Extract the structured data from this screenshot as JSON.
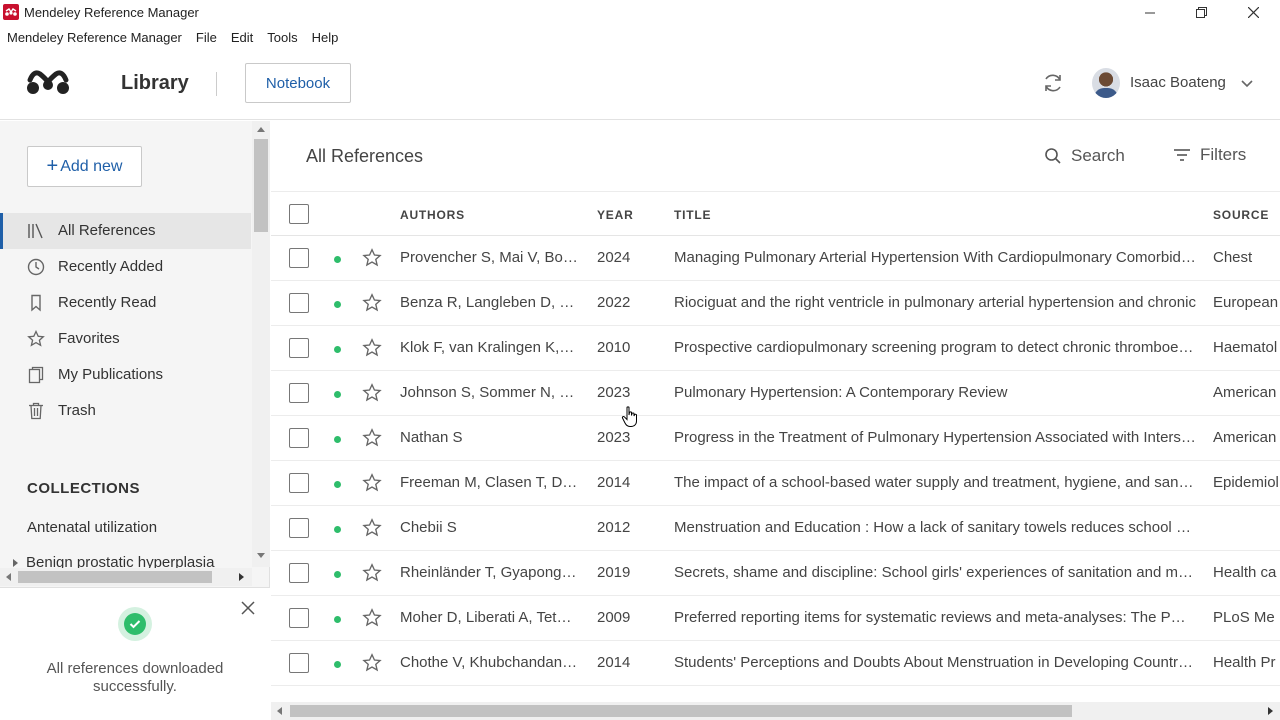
{
  "window": {
    "title": "Mendeley Reference Manager"
  },
  "menu": [
    "Mendeley Reference Manager",
    "File",
    "Edit",
    "Tools",
    "Help"
  ],
  "header": {
    "library_label": "Library",
    "notebook_label": "Notebook",
    "user_name": "Isaac Boateng"
  },
  "sidebar": {
    "add_new_label": "Add new",
    "items": [
      {
        "label": "All References",
        "icon": "library-icon",
        "active": true
      },
      {
        "label": "Recently Added",
        "icon": "clock-icon"
      },
      {
        "label": "Recently Read",
        "icon": "bookmark-icon"
      },
      {
        "label": "Favorites",
        "icon": "star-icon"
      },
      {
        "label": "My Publications",
        "icon": "publications-icon"
      },
      {
        "label": "Trash",
        "icon": "trash-icon"
      }
    ],
    "collections_header": "COLLECTIONS",
    "collections": [
      "Antenatal utilization",
      "Benign prostatic hyperplasia"
    ]
  },
  "toast": {
    "message": "All references downloaded successfully."
  },
  "main": {
    "title": "All References",
    "search_label": "Search",
    "filters_label": "Filters",
    "columns": {
      "authors": "AUTHORS",
      "year": "YEAR",
      "title": "TITLE",
      "source": "SOURCE"
    },
    "rows": [
      {
        "authors": "Provencher S, Mai V, Bonnet S",
        "year": "2024",
        "title": "Managing Pulmonary Arterial Hypertension With Cardiopulmonary Comorbidities",
        "source": "Chest"
      },
      {
        "authors": "Benza R, Langleben D, Hemnes A",
        "year": "2022",
        "title": "Riociguat and the right ventricle in pulmonary arterial hypertension and chronic",
        "source": "European"
      },
      {
        "authors": "Klok F, van Kralingen K, van Dijk A",
        "year": "2010",
        "title": "Prospective cardiopulmonary screening program to detect chronic thromboembolic",
        "source": "Haematol"
      },
      {
        "authors": "Johnson S, Sommer N, Cox-Flaherty K",
        "year": "2023",
        "title": "Pulmonary Hypertension: A Contemporary Review",
        "source": "American"
      },
      {
        "authors": "Nathan S",
        "year": "2023",
        "title": "Progress in the Treatment of Pulmonary Hypertension Associated with Interstitial",
        "source": "American"
      },
      {
        "authors": "Freeman M, Clasen T, Dreibelbis R",
        "year": "2014",
        "title": "The impact of a school-based water supply and treatment, hygiene, and sanitation",
        "source": "Epidemiol"
      },
      {
        "authors": "Chebii S",
        "year": "2012",
        "title": "Menstruation and Education : How a lack of sanitary towels reduces school attendance",
        "source": ""
      },
      {
        "authors": "Rheinländer T, Gyapong M, Akpakli D",
        "year": "2019",
        "title": "Secrets, shame and discipline: School girls' experiences of sanitation and menstrual",
        "source": "Health ca"
      },
      {
        "authors": "Moher D, Liberati A, Tetzlaff J",
        "year": "2009",
        "title": "Preferred reporting items for systematic reviews and meta-analyses: The PRISMA",
        "source": "PLoS Me"
      },
      {
        "authors": "Chothe V, Khubchandani J, Seabert D",
        "year": "2014",
        "title": "Students' Perceptions and Doubts About Menstruation in Developing Countries",
        "source": "Health Pr"
      }
    ]
  },
  "colors": {
    "accent": "#1f5fa8",
    "success": "#2ebd6b",
    "brand_red": "#c8102e"
  }
}
